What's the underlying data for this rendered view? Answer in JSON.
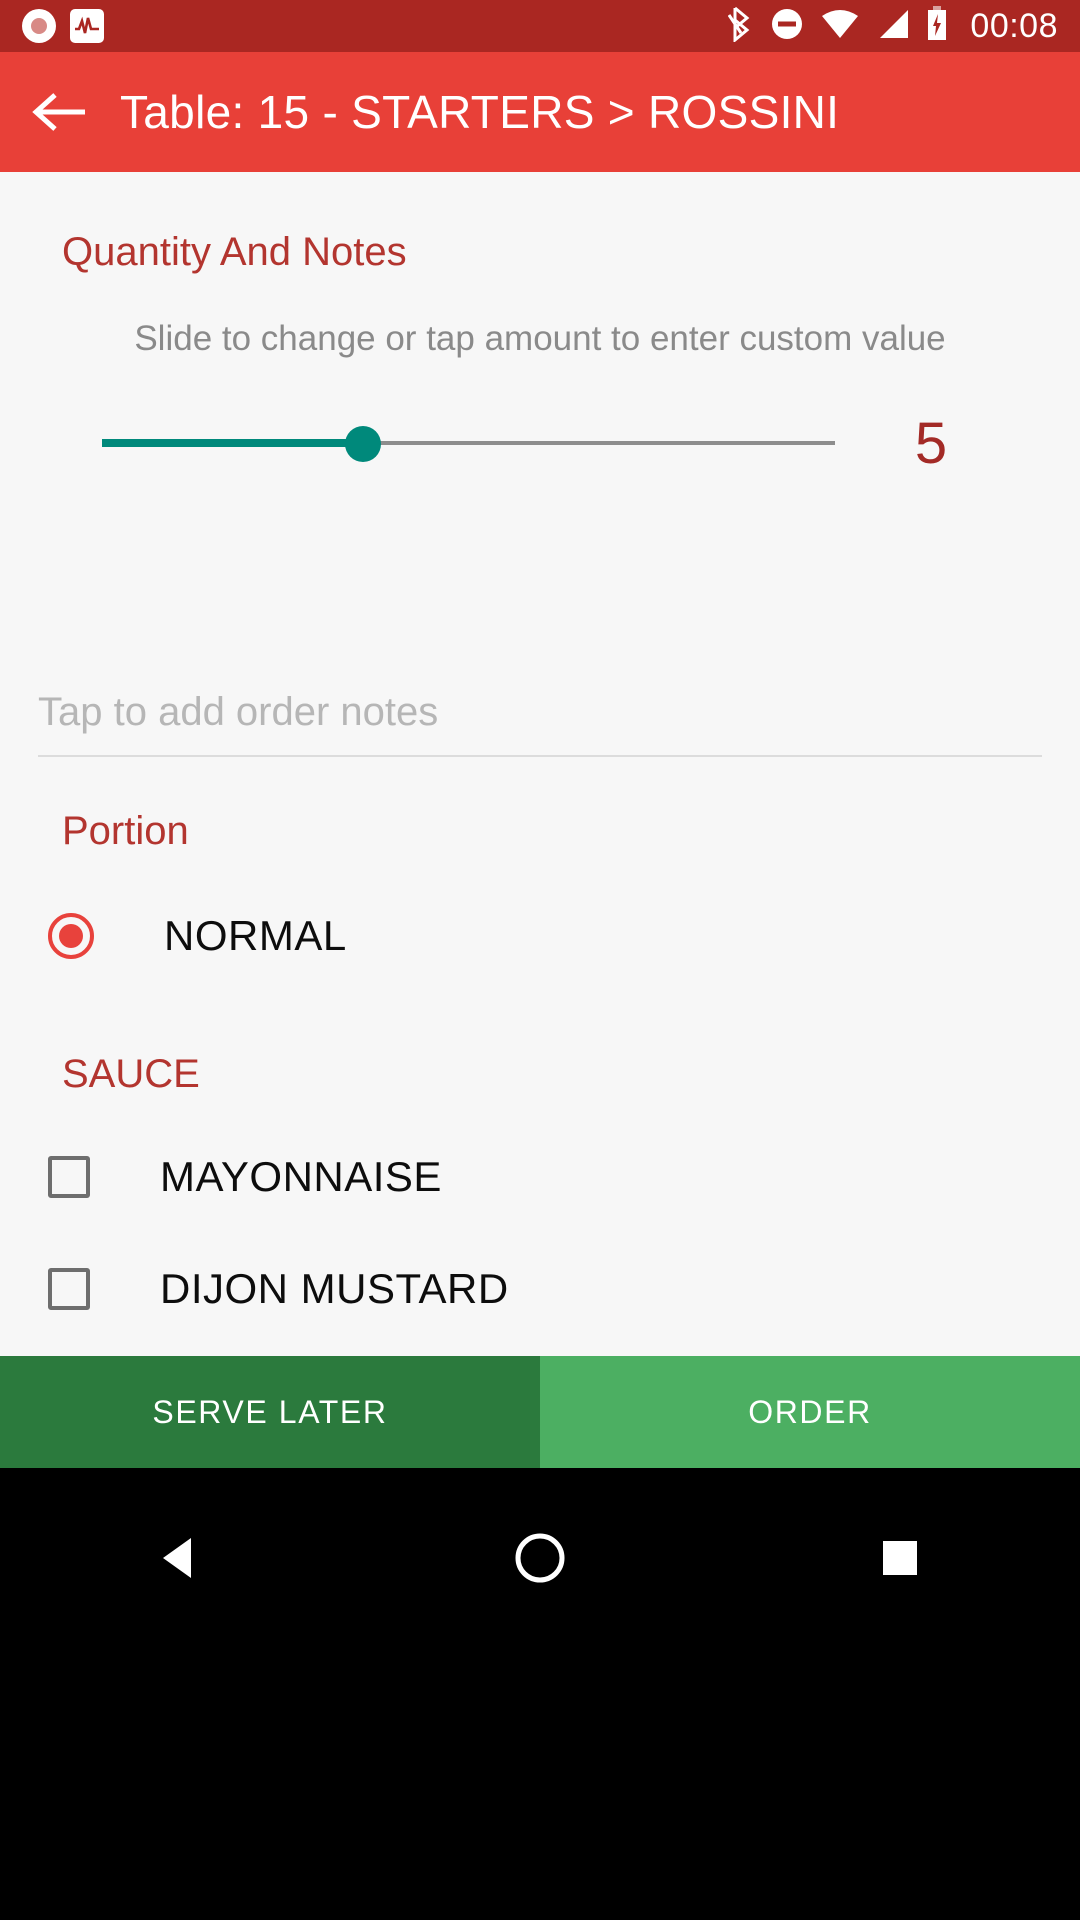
{
  "status_bar": {
    "time": "00:08",
    "background": "#aa2722",
    "icons": [
      {
        "name": "screen-record-icon",
        "glyph": "record"
      },
      {
        "name": "activity-pulse-icon",
        "glyph": "pulse"
      },
      {
        "name": "bluetooth-icon",
        "glyph": "bluetooth"
      },
      {
        "name": "do-not-disturb-icon",
        "glyph": "minus-circle"
      },
      {
        "name": "wifi-icon",
        "glyph": "wifi"
      },
      {
        "name": "cellular-signal-icon",
        "glyph": "signal"
      },
      {
        "name": "battery-charging-icon",
        "glyph": "battery-bolt"
      }
    ]
  },
  "app_bar": {
    "back_icon": "arrow-left-icon",
    "title": "Table: 15 - STARTERS > ROSSINI",
    "background": "#e84038",
    "title_color": "#ffffff"
  },
  "quantity_section": {
    "heading": "Quantity And Notes",
    "heading_color": "#b3352f",
    "hint": "Slide to change or tap amount to enter custom value",
    "hint_color": "#8a8a8a",
    "slider": {
      "value": 5,
      "min": 1,
      "max": 14,
      "fill_percent": 36,
      "fill_color": "#00897b",
      "track_color": "#8d8d8d",
      "thumb_color": "#00897b"
    },
    "value_display": "5",
    "value_color": "#a32a26"
  },
  "notes": {
    "value": "",
    "placeholder": "Tap to add order notes",
    "placeholder_color": "#b6b6b6"
  },
  "portion_section": {
    "heading": "Portion",
    "heading_color": "#b3352f",
    "options": [
      {
        "label": "NORMAL",
        "selected": true,
        "control": "radio",
        "accent": "#e8423c"
      }
    ]
  },
  "sauce_section": {
    "heading": "SAUCE",
    "heading_color": "#b3352f",
    "options": [
      {
        "label": "MAYONNAISE",
        "checked": false,
        "control": "checkbox"
      },
      {
        "label": "DIJON MUSTARD",
        "checked": false,
        "control": "checkbox"
      }
    ]
  },
  "action_bar": {
    "serve_later_label": "SERVE LATER",
    "serve_later_color": "#2b7a3d",
    "order_label": "ORDER",
    "order_color": "#4caf62"
  },
  "nav_bar": {
    "background": "#000000",
    "buttons": [
      {
        "name": "nav-back-button",
        "glyph": "triangle-left"
      },
      {
        "name": "nav-home-button",
        "glyph": "circle"
      },
      {
        "name": "nav-recents-button",
        "glyph": "square"
      }
    ]
  }
}
